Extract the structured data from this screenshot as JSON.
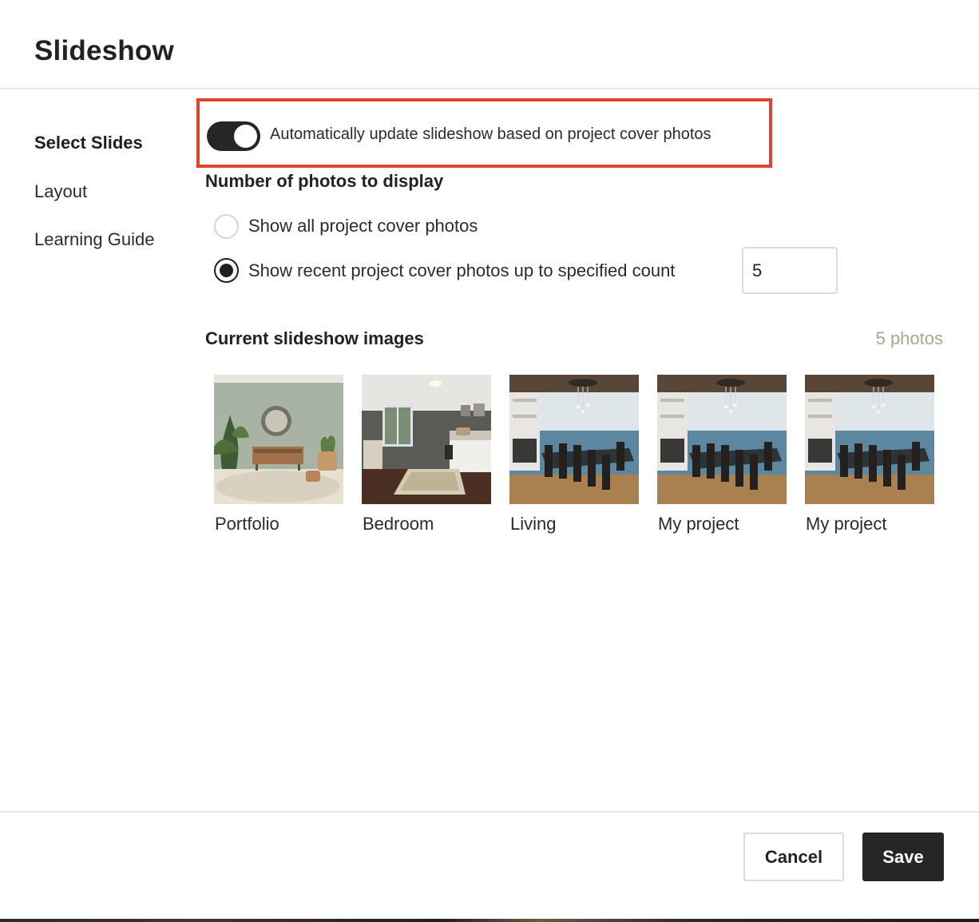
{
  "dialog": {
    "title": "Slideshow"
  },
  "sidebar": {
    "items": [
      {
        "label": "Select Slides",
        "active": true
      },
      {
        "label": "Layout",
        "active": false
      },
      {
        "label": "Learning Guide",
        "active": false
      }
    ]
  },
  "auto_update": {
    "label": "Automatically update slideshow based on project cover photos",
    "enabled": true,
    "highlight_color": "#e0432e"
  },
  "photo_count_section": {
    "heading": "Number of photos to display",
    "options": [
      {
        "label": "Show all project cover photos",
        "selected": false
      },
      {
        "label": "Show recent project cover photos up to specified count",
        "selected": true
      }
    ],
    "count_value": "5"
  },
  "slideshow_images": {
    "heading": "Current slideshow images",
    "count_label": "5 photos",
    "items": [
      {
        "label": "Portfolio",
        "scene": "living-room-icon"
      },
      {
        "label": "Bedroom",
        "scene": "bedroom-icon"
      },
      {
        "label": "Living",
        "scene": "dining-ocean-icon"
      },
      {
        "label": "My project",
        "scene": "dining-ocean-icon"
      },
      {
        "label": "My project",
        "scene": "dining-ocean-icon"
      }
    ]
  },
  "footer": {
    "cancel_label": "Cancel",
    "save_label": "Save"
  },
  "colors": {
    "primary_button": "#262626",
    "count_text": "#a3ab8f",
    "toggle_on": "#262626"
  }
}
